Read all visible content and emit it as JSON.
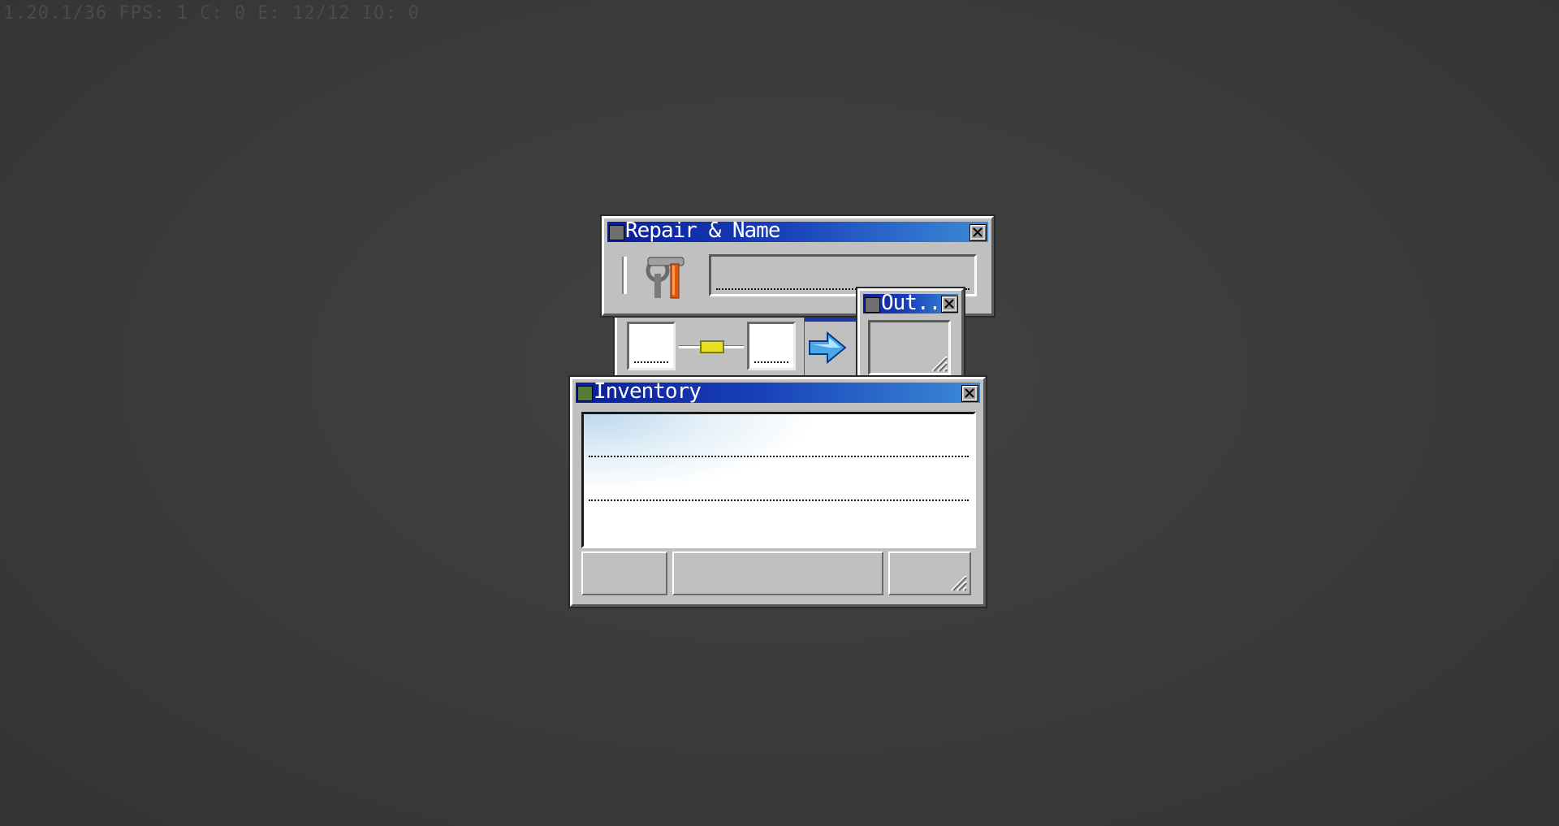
{
  "debug_text": "1.20.1/36 FPS: 1 C: 0 E: 12/12 IO: 0",
  "anvil_window": {
    "title": "Repair & Name",
    "icons": [
      "window-icon",
      "anvil-tools-icon",
      "close-icon"
    ]
  },
  "output_window": {
    "title": "Out..."
  },
  "inventory_window": {
    "title": "Inventory"
  },
  "colors": {
    "title_bar_start": "#0a1e9a",
    "title_bar_end": "#3b8ad8",
    "window_face": "#c0c0c0",
    "background": "#3a3c3c"
  }
}
